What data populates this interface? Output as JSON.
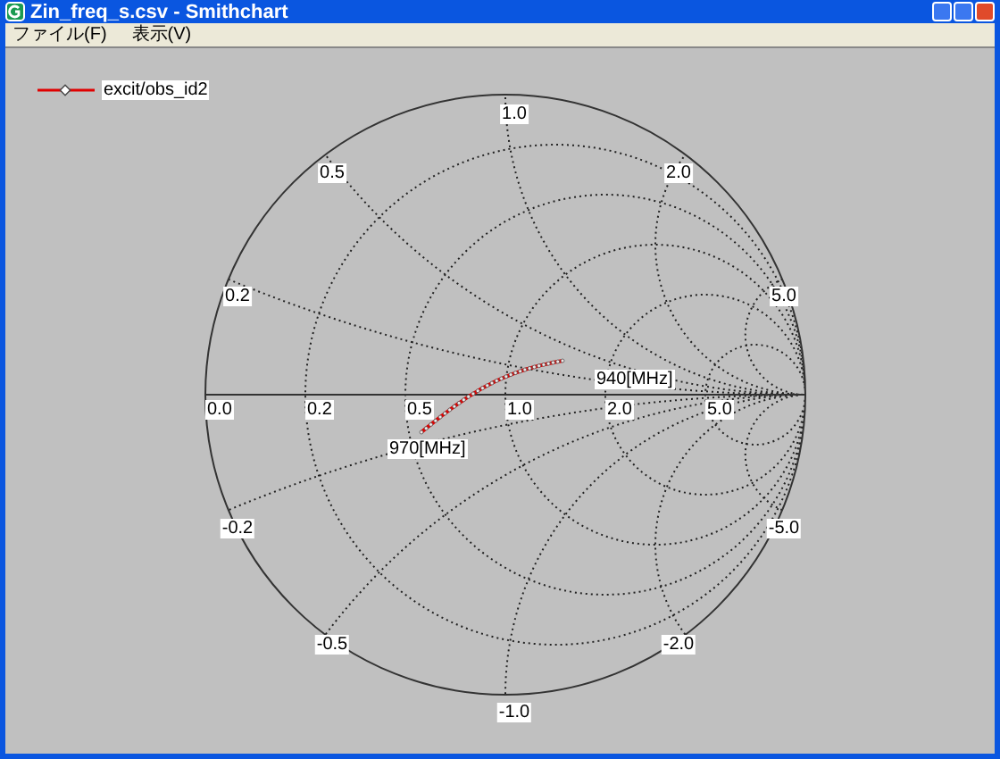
{
  "window": {
    "title": "Zin_freq_s.csv - Smithchart"
  },
  "menu": [
    {
      "label": "ファイル(F)"
    },
    {
      "label": "表示(V)"
    }
  ],
  "legend": {
    "label": "excit/obs_id2"
  },
  "smith_chart": {
    "resistance_labels": [
      "0.0",
      "0.2",
      "0.5",
      "1.0",
      "2.0",
      "5.0"
    ],
    "reactance_labels": [
      "1.0",
      "0.5",
      "2.0",
      "0.2",
      "5.0",
      "-0.2",
      "-5.0",
      "-0.5",
      "-2.0",
      "-1.0"
    ],
    "markers": [
      {
        "label": "940[MHz]"
      },
      {
        "label": "970[MHz]"
      }
    ]
  }
}
